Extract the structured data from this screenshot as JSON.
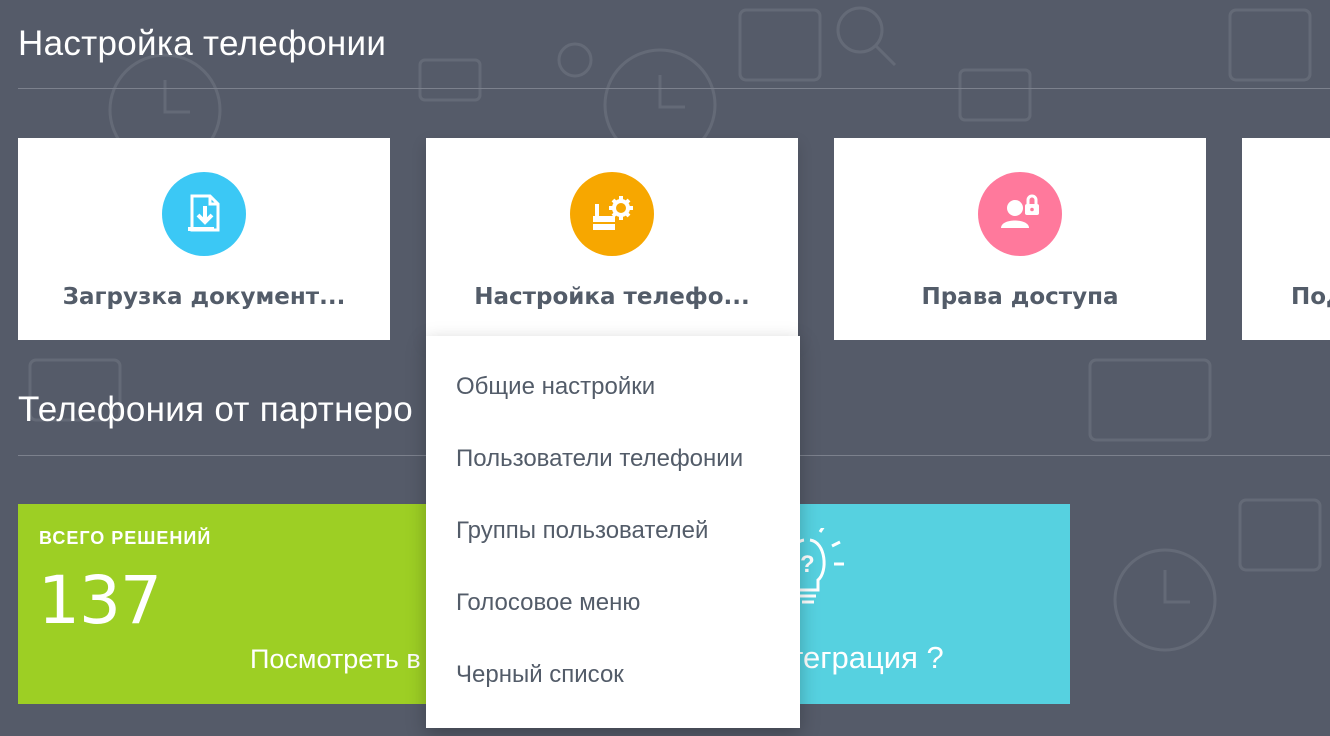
{
  "sections": {
    "telephony_settings_title": "Настройка телефонии",
    "partners_title": "Телефония от партнеро"
  },
  "tiles": [
    {
      "label": "Загрузка документ...",
      "icon": "document-download-icon",
      "color": "#3bc8f5"
    },
    {
      "label": "Настройка телефо...",
      "icon": "phone-settings-icon",
      "color": "#f7a700"
    },
    {
      "label": "Права доступа",
      "icon": "user-lock-icon",
      "color": "#ff799c"
    },
    {
      "label": "Под",
      "icon": "",
      "color": ""
    }
  ],
  "dropdown": {
    "items": [
      "Общие настройки",
      "Пользователи телефонии",
      "Группы пользователей",
      "Голосовое меню",
      "Черный список"
    ]
  },
  "stats": {
    "total_caption": "ВСЕГО РЕШЕНИЙ",
    "total_value": "137",
    "view_link": "Посмотреть в",
    "integration_label": "нтеграция ?",
    "integration_icon": "lightbulb-question-icon"
  }
}
